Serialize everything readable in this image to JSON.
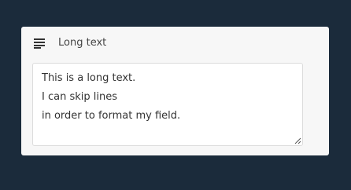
{
  "field": {
    "icon": "text-lines-icon",
    "label": "Long text",
    "value": "This is a long text.\nI can skip lines\nin order to format my field."
  }
}
